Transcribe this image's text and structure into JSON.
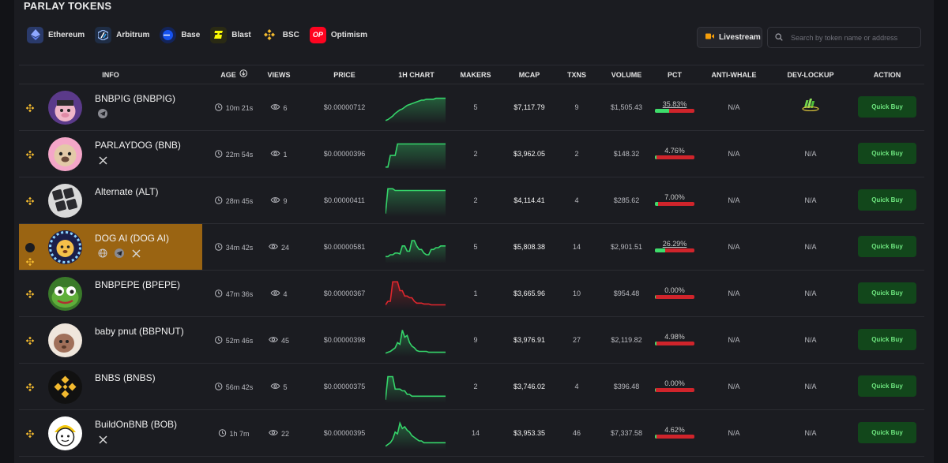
{
  "page": {
    "title": "PARLAY TOKENS"
  },
  "chains": [
    {
      "label": "Ethereum",
      "icon": "ethereum-icon"
    },
    {
      "label": "Arbitrum",
      "icon": "arbitrum-icon"
    },
    {
      "label": "Base",
      "icon": "base-icon"
    },
    {
      "label": "Blast",
      "icon": "blast-icon"
    },
    {
      "label": "BSC",
      "icon": "bsc-icon"
    },
    {
      "label": "Optimism",
      "icon": "optimism-icon"
    }
  ],
  "toolbar": {
    "livestream_label": "Livestream",
    "search_placeholder": "Search by token name or address"
  },
  "table": {
    "headers": {
      "info": "INFO",
      "age": "AGE",
      "views": "VIEWS",
      "price": "PRICE",
      "chart": "1H CHART",
      "makers": "MAKERS",
      "mcap": "MCAP",
      "txns": "TXNS",
      "volume": "VOLUME",
      "pct": "PCT",
      "anti_whale": "ANTI-WHALE",
      "dev_lockup": "DEV-LOCKUP",
      "action": "ACTION"
    },
    "action_label": "Quick Buy",
    "rows": [
      {
        "name": "BNBPIG (BNBPIG)",
        "socials": [
          "telegram"
        ],
        "age": "10m 21s",
        "views": "6",
        "price": "$0.00000712",
        "makers": "5",
        "mcap": "$7,117.79",
        "txns": "9",
        "volume": "$1,505.43",
        "pct": "35.83%",
        "pct_value": 35.83,
        "anti_whale": "N/A",
        "dev_lockup": "",
        "chart_color": "#35d46a",
        "chart": [
          2,
          3,
          5,
          7,
          10,
          12,
          14,
          15,
          17,
          19,
          20,
          21,
          22,
          23,
          24,
          25,
          25,
          26,
          26,
          26,
          26,
          27,
          27,
          27,
          27,
          27
        ]
      },
      {
        "name": "PARLAYDOG (BNB)",
        "socials": [
          "x"
        ],
        "age": "22m 54s",
        "views": "1",
        "price": "$0.00000396",
        "makers": "2",
        "mcap": "$3,962.05",
        "txns": "2",
        "volume": "$148.32",
        "pct": "4.76%",
        "pct_value": 4.76,
        "anti_whale": "N/A",
        "dev_lockup": "N/A",
        "chart_color": "#35d46a",
        "chart": [
          2,
          2,
          15,
          15,
          15,
          28,
          28,
          28,
          28,
          28,
          28,
          28,
          28,
          28,
          28,
          28,
          28,
          28,
          28,
          28,
          28,
          28,
          28,
          28,
          28,
          28
        ]
      },
      {
        "name": "Alternate (ALT)",
        "socials": [],
        "age": "28m 45s",
        "views": "9",
        "price": "$0.00000411",
        "makers": "2",
        "mcap": "$4,114.41",
        "txns": "4",
        "volume": "$285.62",
        "pct": "7.00%",
        "pct_value": 7.0,
        "anti_whale": "N/A",
        "dev_lockup": "N/A",
        "chart_color": "#35d46a",
        "chart": [
          2,
          30,
          30,
          30,
          28,
          28,
          28,
          28,
          28,
          28,
          28,
          28,
          28,
          28,
          28,
          28,
          28,
          28,
          28,
          28,
          28,
          28,
          28,
          28,
          28,
          28
        ]
      },
      {
        "name": "DOG AI (DOG AI)",
        "socials": [
          "globe",
          "telegram",
          "x"
        ],
        "age": "34m 42s",
        "views": "24",
        "price": "$0.00000581",
        "makers": "5",
        "mcap": "$5,808.38",
        "txns": "14",
        "volume": "$2,901.51",
        "pct": "26.29%",
        "pct_value": 26.29,
        "anti_whale": "N/A",
        "dev_lockup": "N/A",
        "chart_color": "#35d46a",
        "chart": [
          6,
          6,
          8,
          8,
          10,
          10,
          9,
          18,
          18,
          12,
          12,
          24,
          24,
          18,
          14,
          14,
          10,
          8,
          8,
          14,
          14,
          16,
          16,
          18,
          18,
          18
        ]
      },
      {
        "name": "BNBPEPE (BPEPE)",
        "socials": [],
        "age": "47m 36s",
        "views": "4",
        "price": "$0.00000367",
        "makers": "1",
        "mcap": "$3,665.96",
        "txns": "10",
        "volume": "$954.48",
        "pct": "0.00%",
        "pct_value": 0.0,
        "anti_whale": "N/A",
        "dev_lockup": "N/A",
        "chart_color": "#e0262d",
        "chart": [
          4,
          8,
          8,
          30,
          30,
          30,
          20,
          20,
          14,
          14,
          12,
          12,
          8,
          6,
          6,
          6,
          5,
          5,
          5,
          4,
          4,
          4,
          4,
          4,
          4,
          4
        ]
      },
      {
        "name": "baby pnut (BBPNUT)",
        "socials": [],
        "age": "52m 46s",
        "views": "45",
        "price": "$0.00000398",
        "makers": "9",
        "mcap": "$3,976.91",
        "txns": "27",
        "volume": "$2,119.82",
        "pct": "4.98%",
        "pct_value": 4.98,
        "anti_whale": "N/A",
        "dev_lockup": "N/A",
        "chart_color": "#35d46a",
        "chart": [
          2,
          3,
          4,
          6,
          8,
          14,
          12,
          28,
          20,
          22,
          14,
          10,
          8,
          5,
          4,
          4,
          4,
          4,
          3,
          3,
          3,
          3,
          3,
          3,
          3,
          3
        ]
      },
      {
        "name": "BNBS (BNBS)",
        "socials": [],
        "age": "56m 42s",
        "views": "5",
        "price": "$0.00000375",
        "makers": "2",
        "mcap": "$3,746.02",
        "txns": "4",
        "volume": "$396.48",
        "pct": "0.00%",
        "pct_value": 0.0,
        "anti_whale": "N/A",
        "dev_lockup": "N/A",
        "chart_color": "#35d46a",
        "chart": [
          2,
          28,
          28,
          28,
          14,
          14,
          14,
          12,
          12,
          8,
          8,
          6,
          6,
          6,
          6,
          6,
          6,
          6,
          6,
          6,
          6,
          6,
          6,
          6,
          6,
          6
        ]
      },
      {
        "name": "BuildOnBNB (BOB)",
        "socials": [
          "x"
        ],
        "age": "1h 7m",
        "views": "22",
        "price": "$0.00000395",
        "makers": "14",
        "mcap": "$3,953.35",
        "txns": "46",
        "volume": "$7,337.58",
        "pct": "4.62%",
        "pct_value": 4.62,
        "anti_whale": "N/A",
        "dev_lockup": "N/A",
        "chart_color": "#35d46a",
        "chart": [
          2,
          4,
          6,
          10,
          18,
          16,
          28,
          22,
          24,
          20,
          18,
          14,
          12,
          10,
          8,
          8,
          6,
          6,
          6,
          6,
          6,
          6,
          6,
          6,
          6,
          6
        ]
      }
    ]
  },
  "colors": {
    "accent_green": "#35d46a",
    "danger_red": "#e0262d",
    "highlight_row": "#9a6412",
    "buy_button_bg": "#12471b"
  }
}
